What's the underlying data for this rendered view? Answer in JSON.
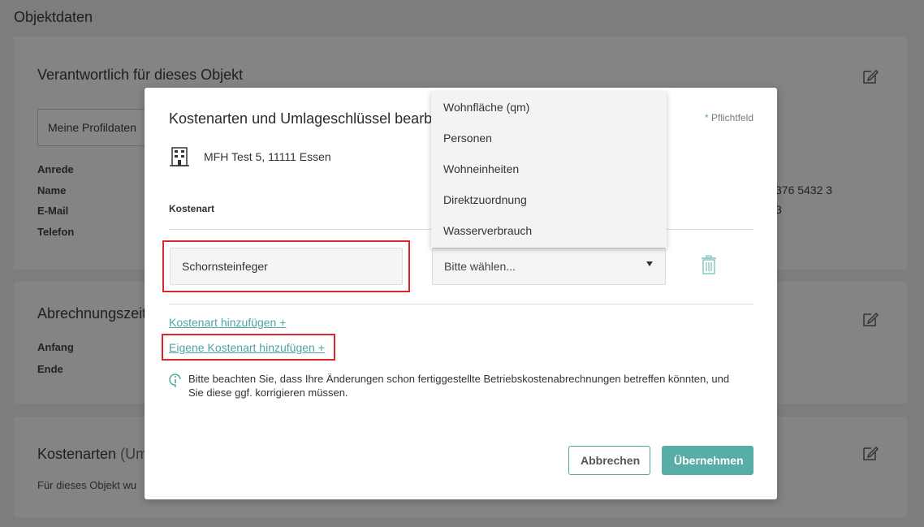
{
  "page": {
    "title": "Objektdaten",
    "cards": {
      "responsible": {
        "title": "Verantwortlich für dieses Objekt",
        "profile_button": "Meine Profildaten",
        "labels": [
          "Anrede",
          "Name",
          "E-Mail",
          "Telefon"
        ],
        "phone_partial": "376 5432 3",
        "partial_2": "3"
      },
      "billing": {
        "title": "Abrechnungszeit",
        "labels": [
          "Anfang",
          "Ende"
        ]
      },
      "costs": {
        "title": "Kostenarten",
        "title_sub": " (Um",
        "text": "Für dieses Objekt wu"
      }
    }
  },
  "modal": {
    "title": "Kostenarten und Umlageschlüssel bearbe",
    "required_star": "*",
    "required_label": " Pflichtfeld",
    "object_name": "MFH Test 5, 11111 Essen",
    "column_header": "Kostenart",
    "cost_type_value": "Schornsteinfeger",
    "select_placeholder": "Bitte wählen...",
    "add_cost_link": "Kostenart hinzufügen +",
    "add_own_cost_link": "Eigene Kostenart hinzufügen +",
    "info_text": "Bitte beachten Sie, dass Ihre Änderungen schon fertiggestellte Betriebskostenabrechnungen betreffen könnten, und Sie diese ggf. korrigieren müssen.",
    "cancel_label": "Abbrechen",
    "submit_label": "Übernehmen"
  },
  "dropdown": {
    "options": [
      "Wohnfläche (qm)",
      "Personen",
      "Wohneinheiten",
      "Direktzuordnung",
      "Wasserverbrauch"
    ]
  },
  "colors": {
    "accent": "#4ca6a0",
    "highlight": "#d9262c"
  }
}
